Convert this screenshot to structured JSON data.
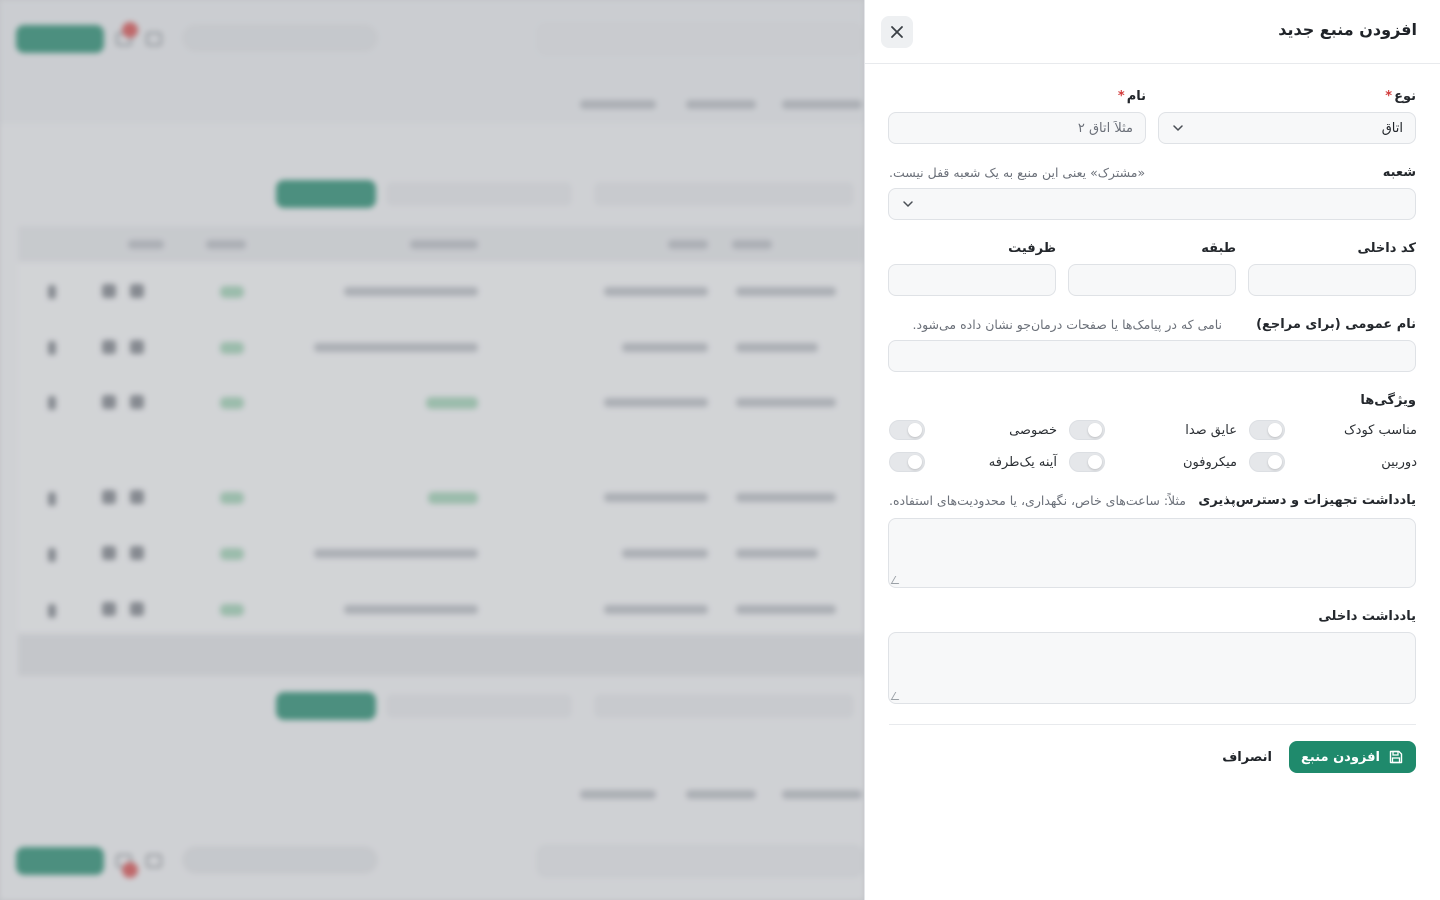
{
  "drawer": {
    "title": "افزودن منبع جدید",
    "type_field": {
      "label": "نوع",
      "required_mark": "*",
      "value": "اتاق"
    },
    "name_field": {
      "label": "نام",
      "required_mark": "*",
      "placeholder": "مثلاً اتاق ۲"
    },
    "branch_field": {
      "label": "شعبه",
      "hint": "«مشترک» یعنی این منبع به یک شعبه قفل نیست.",
      "value": ""
    },
    "internal_code_field": {
      "label": "کد داخلی",
      "value": ""
    },
    "floor_field": {
      "label": "طبقه",
      "value": ""
    },
    "capacity_field": {
      "label": "ظرفیت",
      "value": ""
    },
    "public_name_field": {
      "label": "نام عمومی (برای مراجع)",
      "hint": "نامی که در پیامک‌ها یا صفحات درمان‌جو نشان داده می‌شود.",
      "value": ""
    },
    "features": {
      "label": "ویژگی‌ها",
      "items": [
        {
          "label": "خصوصی",
          "on": false
        },
        {
          "label": "عایق صدا",
          "on": false
        },
        {
          "label": "مناسب کودک",
          "on": false
        },
        {
          "label": "آینه یک‌طرفه",
          "on": false
        },
        {
          "label": "میکروفون",
          "on": false
        },
        {
          "label": "دوربین",
          "on": false
        }
      ]
    },
    "equipment_note": {
      "label": "یادداشت تجهیزات و دسترس‌پذیری",
      "hint": "مثلاً: ساعت‌های خاص، نگهداری، یا محدودیت‌های استفاده."
    },
    "internal_note": {
      "label": "یادداشت داخلی"
    },
    "actions": {
      "submit": "افزودن منبع",
      "cancel": "انصراف"
    }
  },
  "colors": {
    "primary": "#1f8a6c",
    "required": "#d23b3b",
    "background_overlay": "#9a9ca2"
  },
  "icons": {
    "close": "close-icon",
    "chevron": "chevron-down-icon",
    "save": "save-icon"
  }
}
